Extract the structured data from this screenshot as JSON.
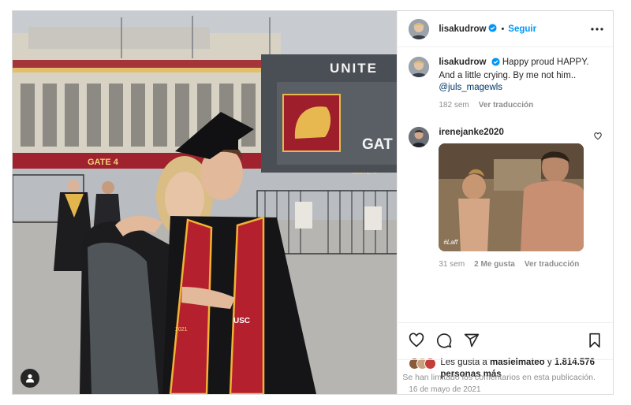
{
  "post": {
    "username": "lisakudrow",
    "verified": true,
    "separator": "•",
    "follow_label": "Seguir",
    "photo": {
      "stadium_sign_1": "UNITE",
      "stadium_sign_2": "GAT",
      "gate_banner": "GATE 4",
      "gate_banner_2": "GATE 4",
      "stole_text": "USC",
      "stole_year": "2021"
    },
    "caption": {
      "username": "lisakudrow",
      "text": "Happy proud HAPPY. And a little crying. By me not him..",
      "mention": "@juls_magewls",
      "time": "182 sem",
      "translate": "Ver traducción"
    },
    "comments": [
      {
        "username": "irenejanke2020",
        "gif_label": "#Laff",
        "time": "31 sem",
        "likes": "2 Me gusta",
        "translate": "Ver traducción"
      }
    ],
    "likes": {
      "prefix": "Les gusta a",
      "user": "masielmateo",
      "connector": "y",
      "count": "1.814.576",
      "suffix": "personas más"
    },
    "date": "16 de mayo de 2021",
    "comments_limited": "Se han limitado los comentarios en esta publicación."
  },
  "colors": {
    "link": "#0095f6",
    "verified": "#0095f6",
    "usc_cardinal": "#b5202e",
    "usc_gold": "#f2b233"
  },
  "icons": {
    "user_tag": "person-icon",
    "verified": "verified-badge-icon",
    "more": "more-horizontal-icon",
    "like": "heart-icon",
    "comment": "comment-bubble-icon",
    "share": "paper-plane-icon",
    "save": "bookmark-icon"
  }
}
